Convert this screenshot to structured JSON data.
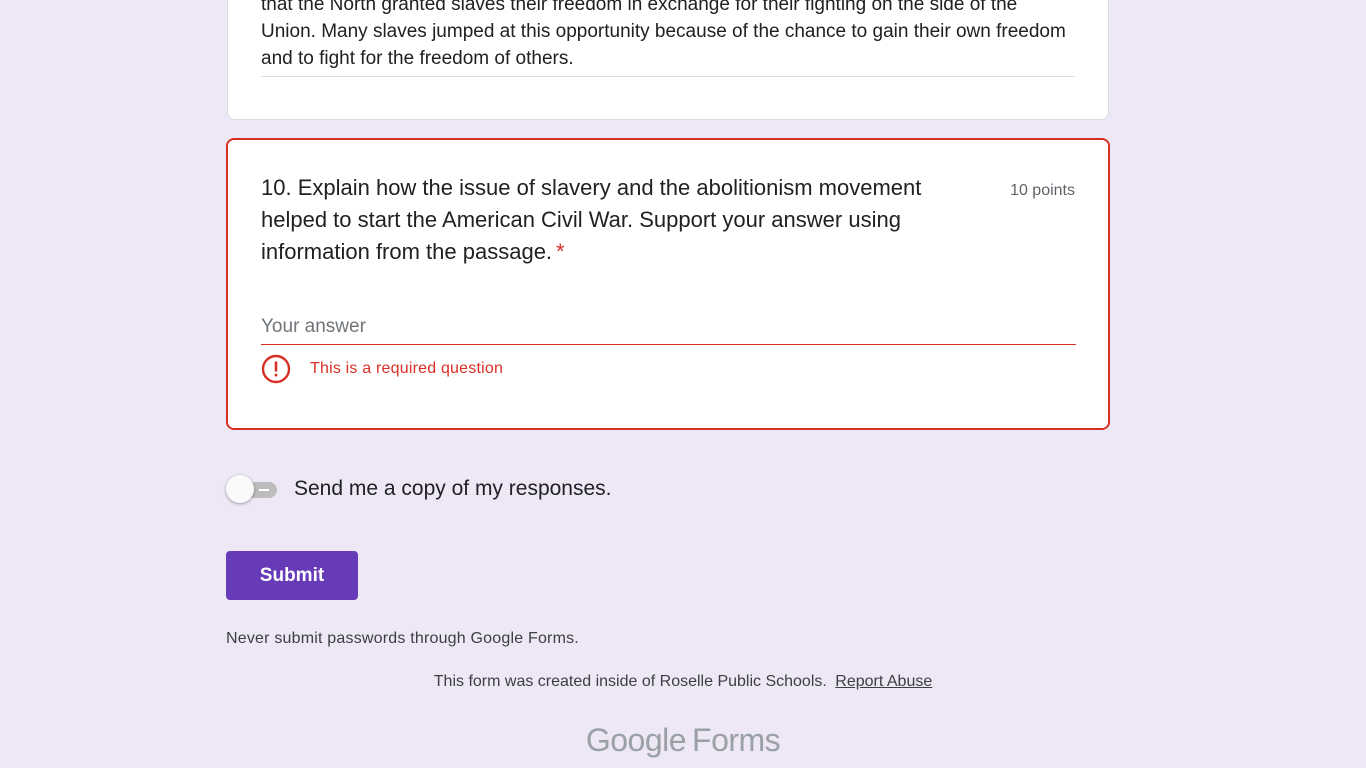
{
  "previous_question": {
    "answer_text": "that the North granted slaves their freedom in exchange for their fighting on the side of the Union. Many slaves jumped at this opportunity because of the chance to gain their own freedom and to fight for the freedom of others."
  },
  "question": {
    "title": "10. Explain how the issue of slavery and the abolitionism movement helped to start the American Civil War. Support your answer using information from the passage.",
    "required_marker": "*",
    "points": "10 points",
    "answer_value": "",
    "answer_placeholder": "Your answer",
    "error_icon": "error-circle-icon",
    "error_text": "This is a required question"
  },
  "copy_toggle": {
    "label": "Send me a copy of my responses.",
    "checked": false
  },
  "submit_label": "Submit",
  "password_warning": "Never submit passwords through Google Forms.",
  "footer": {
    "created_text": "This form was created inside of Roselle Public Schools.",
    "report_link": "Report Abuse"
  },
  "brand": {
    "google": "Google",
    "forms": "Forms"
  },
  "colors": {
    "background": "#ede7f6",
    "accent": "#673ab7",
    "error": "#d93025"
  }
}
